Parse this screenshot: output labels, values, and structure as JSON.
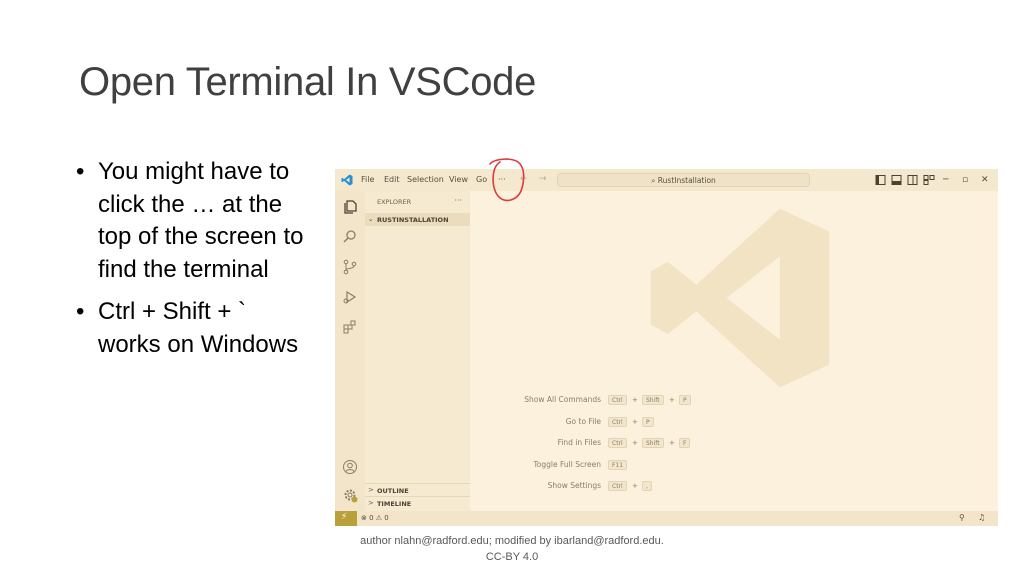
{
  "slide": {
    "title": "Open Terminal In VSCode",
    "bullets": [
      "You might have to click the … at the top of the screen to find the terminal",
      "Ctrl + Shift + ` works on Windows"
    ],
    "bullet_glyph": "•",
    "footer_line1": "author nlahn@radford.edu; modified by ibarland@radford.edu.",
    "footer_line2": "CC-BY 4.0"
  },
  "vscode": {
    "menu": [
      "File",
      "Edit",
      "Selection",
      "View",
      "Go",
      "···"
    ],
    "nav_back": "←",
    "nav_forward": "→",
    "search_text": "RustInstallation",
    "window_controls": [
      "─",
      "▫",
      "✕"
    ],
    "sidebar": {
      "title": "EXPLORER",
      "more": "···",
      "folder": "RUSTINSTALLATION",
      "outline": "OUTLINE",
      "timeline": "TIMELINE"
    },
    "commands": [
      {
        "label": "Show All Commands",
        "keys": [
          "Ctrl",
          "Shift",
          "P"
        ]
      },
      {
        "label": "Go to File",
        "keys": [
          "Ctrl",
          "P"
        ]
      },
      {
        "label": "Find in Files",
        "keys": [
          "Ctrl",
          "Shift",
          "F"
        ]
      },
      {
        "label": "Toggle Full Screen",
        "keys": [
          "F11"
        ]
      },
      {
        "label": "Show Settings",
        "keys": [
          "Ctrl",
          ","
        ]
      }
    ],
    "plus_sign": "+",
    "status": {
      "remote_icon": "remote-icon",
      "problems": "⊗ 0 ⚠ 0",
      "accent": "#b9a03a"
    }
  }
}
